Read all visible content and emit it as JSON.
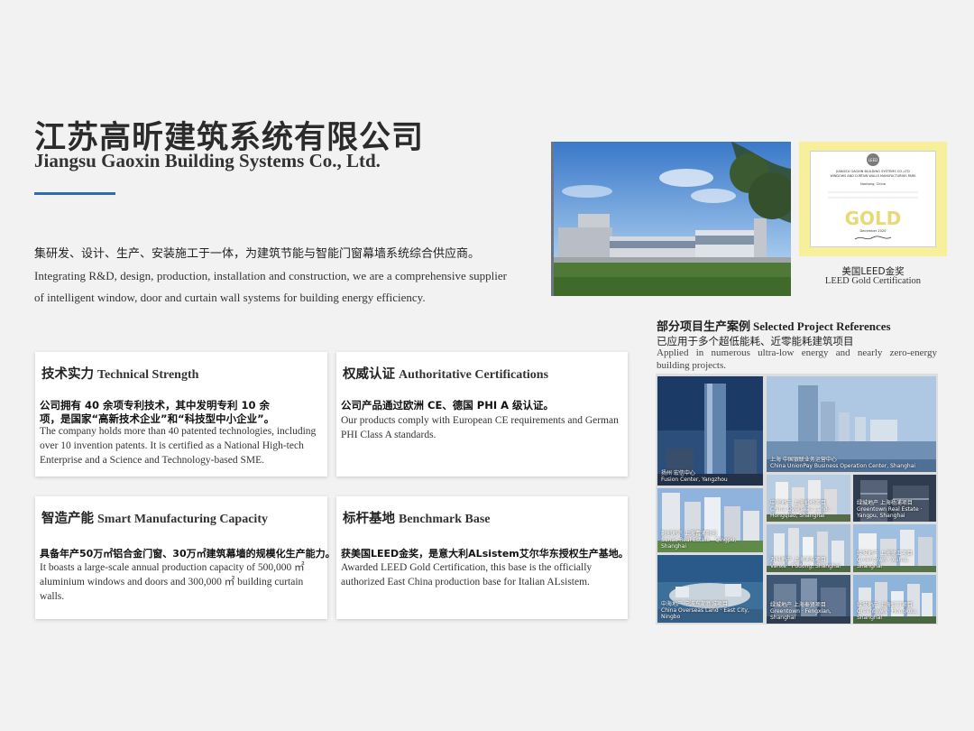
{
  "company": {
    "name_cn": "江苏高昕建筑系统有限公司",
    "name_en": "Jiangsu Gaoxin Building Systems Co., Ltd."
  },
  "intro": {
    "cn": "集研发、设计、生产、安装施工于一体，为建筑节能与智能门窗幕墙系统综合供应商。",
    "en": "Integrating R&D, design, production, installation and construction, we are a comprehensive supplier of intelligent window, door and curtain wall systems for building energy efficiency."
  },
  "cards": [
    {
      "title_cn": "技术实力",
      "title_en": "Technical Strength",
      "body_cn": "公司拥有 40 余项专利技术，其中发明专利 10 余项，是国家“高新技术企业”和“科技型中小企业”。",
      "body_en": "The company holds more than 40 patented technologies, including over 10 invention patents. It is certified as a National High-tech Enterprise and a Science and Technology-based SME."
    },
    {
      "title_cn": "权威认证",
      "title_en": "Authoritative Certifications",
      "body_cn": "公司产品通过欧洲 CE、德国 PHI A 级认证。",
      "body_en": "Our products comply with European CE requirements and German PHI Class A standards."
    },
    {
      "title_cn": "智造产能",
      "title_en": "Smart Manufacturing Capacity",
      "body_cn": "具备年产50万㎡铝合金门窗、30万㎡建筑幕墙的规模化生产能力。",
      "body_en": "It boasts a large-scale annual production capacity of 500,000 ㎡ aluminium windows and doors and 300,000 ㎡ building curtain walls."
    },
    {
      "title_cn": "标杆基地",
      "title_en": "Benchmark Base",
      "body_cn": "获美国LEED金奖，是意大利ALsistem艾尔华东授权生产基地。",
      "body_en": "Awarded LEED Gold Certification, this base is the officially authorized East China production base for Italian ALsistem."
    }
  ],
  "certificate": {
    "caption_cn": "美国LEED金奖",
    "caption_en": "LEED Gold Certification",
    "badge": "LEED",
    "org": "JIANGSU GAOXIN BUILDING SYSTEMS CO.,LTD",
    "site": "WINDOWS AND CURTAIN WALLS MANUFACTURING PARK",
    "location": "Nantong, China",
    "level": "GOLD",
    "date": "December 2020"
  },
  "references": {
    "title_cn": "部分项目生产案例",
    "title_en": "Selected Project References",
    "sub_cn": "已应用于多个超低能耗、近零能耗建筑项目",
    "sub_en": "Applied in numerous ultra-low energy and nearly zero-energy building projects.",
    "tiles": [
      {
        "cap_cn": "扬州 宏信中心",
        "cap_en": "Fusion Center, Yangzhou"
      },
      {
        "cap_cn": "上海 中国银联业务运营中心",
        "cap_en": "China UnionPay Business Operation Center, Shanghai"
      },
      {
        "cap_cn": "融创地产 上海青浦融创",
        "cap_en": "Sunac Real Estate · Qingpu, Shanghai"
      },
      {
        "cap_cn": "中海地产 上海虹桥项目",
        "cap_en": "China Overseas Land · Hongqiao, Shanghai"
      },
      {
        "cap_cn": "绿城地产 上海杨浦项目",
        "cap_en": "Greentown Real Estate · Yangpu, Shanghai"
      },
      {
        "cap_cn": "万科地产 上海浦东项目",
        "cap_en": "Vanke · Pudong, Shanghai"
      },
      {
        "cap_cn": "绿城地产 上海徐汇项目",
        "cap_en": "Greentown · Xuhui, Shanghai"
      },
      {
        "cap_cn": "中海地产 宁波东部新城项目",
        "cap_en": "China Overseas Land · East City, Ningbo"
      },
      {
        "cap_cn": "绿城地产 上海奉贤项目",
        "cap_en": "Greentown · Fengxian, Shanghai"
      },
      {
        "cap_cn": "绿城地产 上海虹口项目",
        "cap_en": "Greentown · Hongkou, Shanghai"
      }
    ]
  },
  "colors": {
    "accent": "#2d6bb5",
    "background": "#f2f2f2",
    "cert_frame": "#f7ef9a",
    "gold": "#d9c25a"
  },
  "icons": [
    "leed-badge-icon"
  ]
}
